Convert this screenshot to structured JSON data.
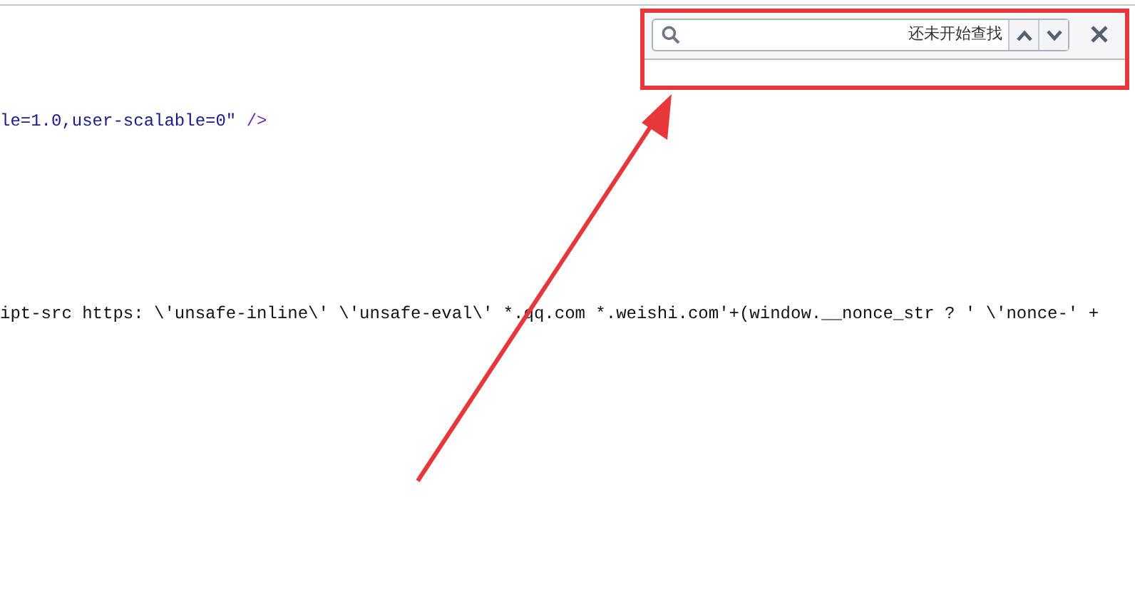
{
  "find_bar": {
    "status": "还未开始查找"
  },
  "code_lines": [
    {
      "segments": [
        {
          "kind": "value",
          "text": "le=1.0,user-scalable=0\""
        },
        {
          "kind": "tag",
          "text": " />"
        }
      ]
    },
    {
      "segments": [
        {
          "kind": "plain",
          "text": "ipt-src https: \\'unsafe-inline\\' \\'unsafe-eval\\' *.qq.com *.weishi.com'+(window.__nonce_str ? ' \\'nonce-' +"
        }
      ]
    }
  ]
}
